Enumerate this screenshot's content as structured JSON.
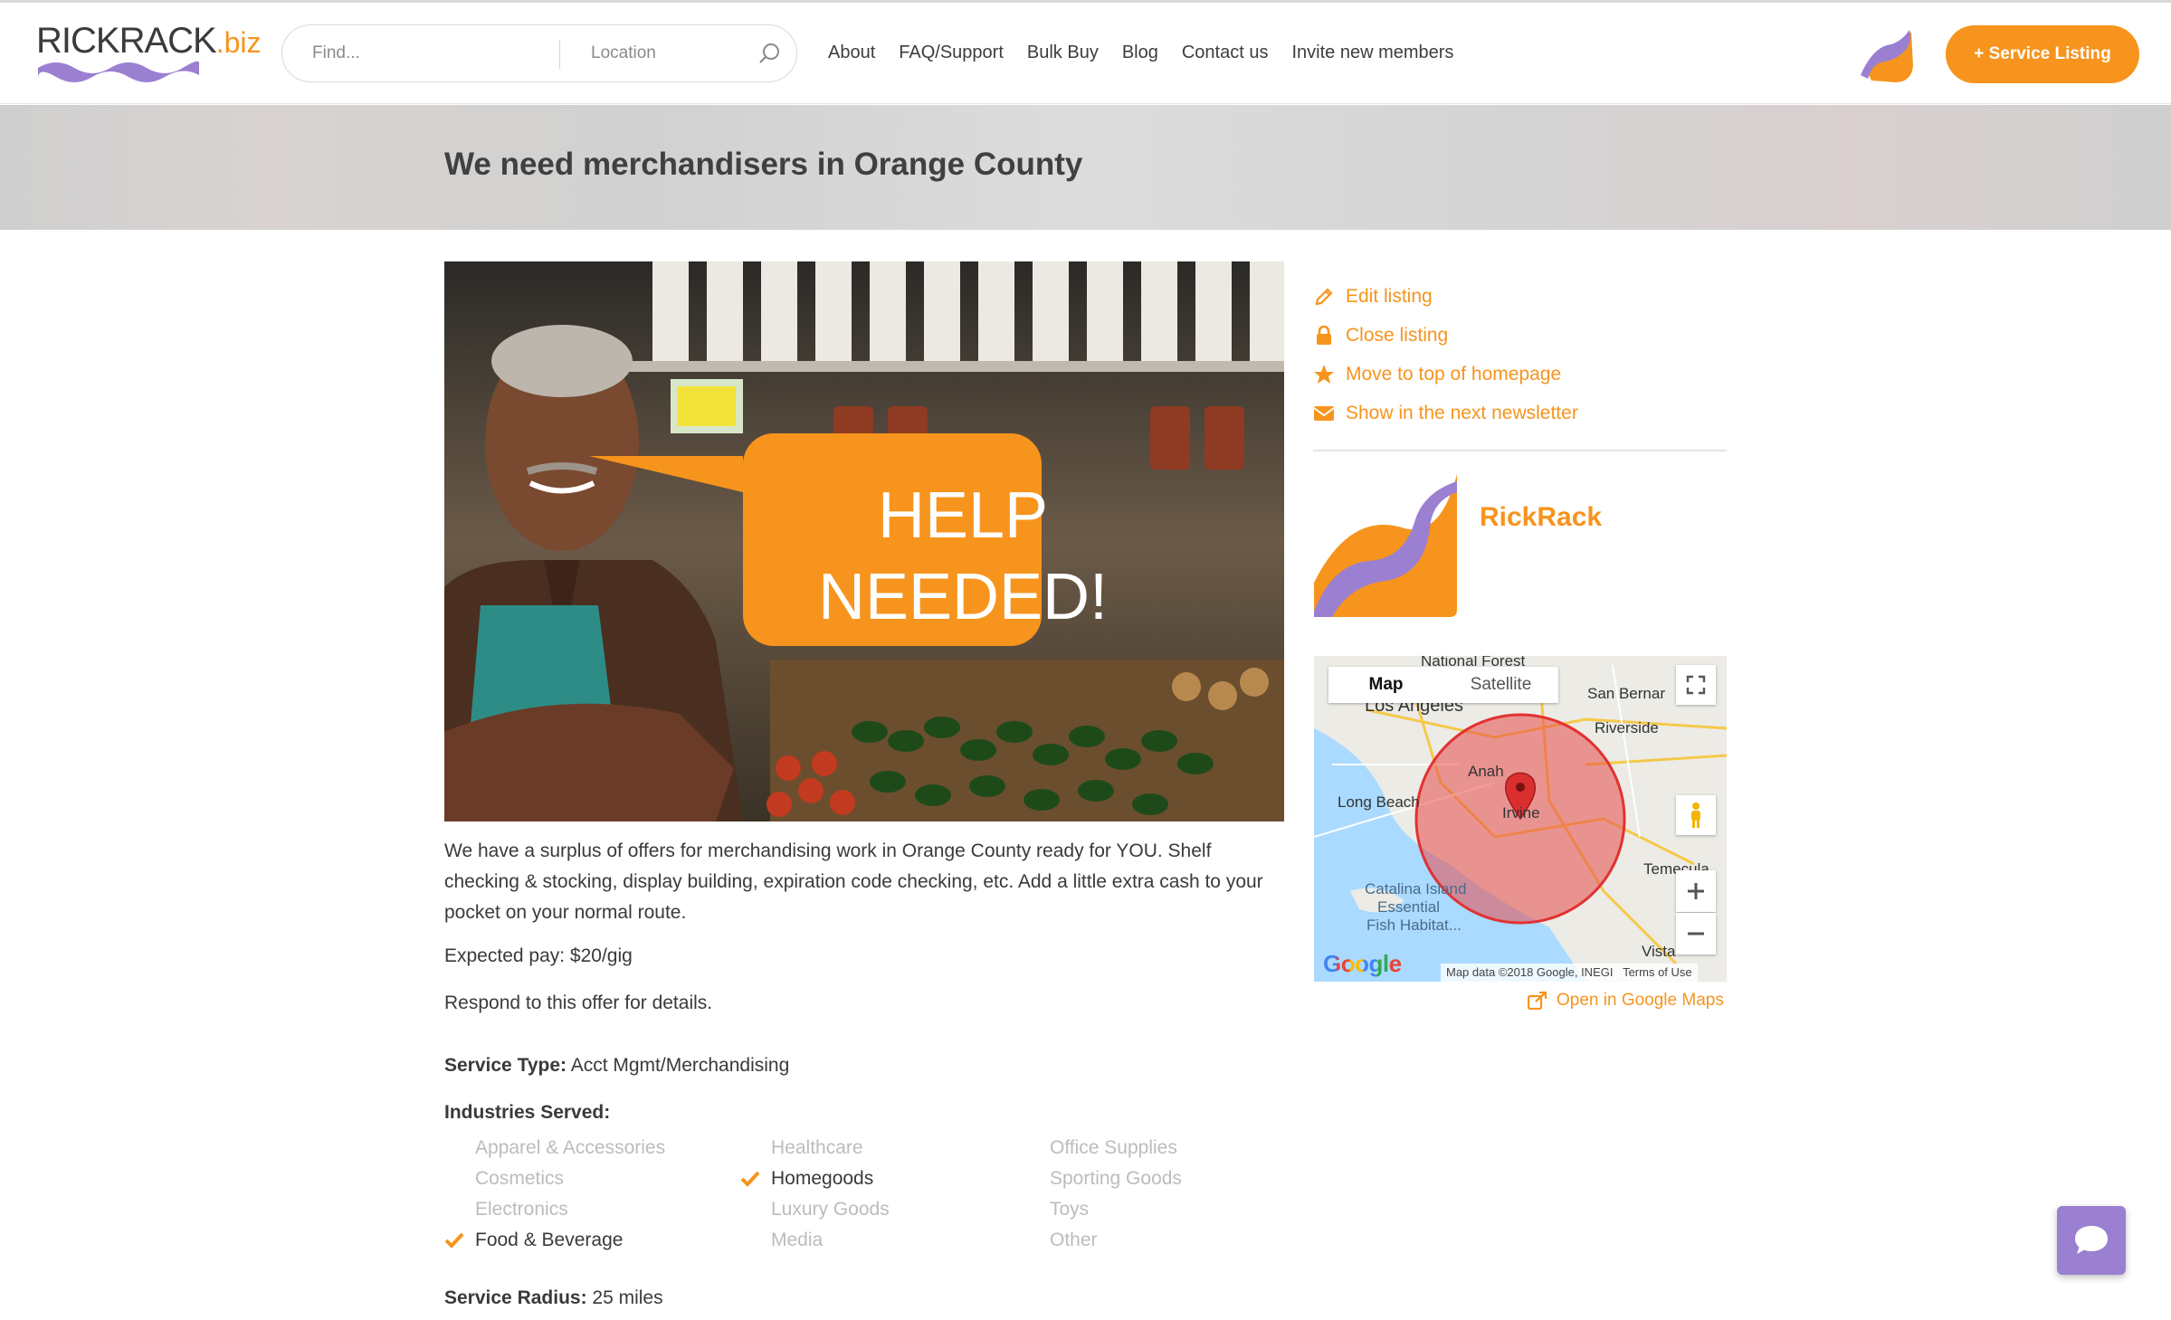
{
  "brand": {
    "logo_main": "RICKRACK",
    "logo_tld": ".biz",
    "orange": "#f7941d",
    "purple": "#9b7fd1"
  },
  "search": {
    "find_placeholder": "Find...",
    "location_placeholder": "Location",
    "icon": "search-icon"
  },
  "nav": [
    "About",
    "FAQ/Support",
    "Bulk Buy",
    "Blog",
    "Contact us",
    "Invite new members"
  ],
  "header": {
    "service_button": "+ Service Listing",
    "avatar_icon": "user-avatar"
  },
  "page": {
    "title": "We need merchandisers in Orange County"
  },
  "hero": {
    "bubble_line1": "HELP",
    "bubble_line2": "NEEDED!"
  },
  "listing": {
    "description": "We have a surplus of offers for merchandising work in Orange County ready for YOU. Shelf checking & stocking, display building, expiration code checking, etc. Add a little extra cash to your pocket on your normal route.",
    "pay": "Expected pay: $20/gig",
    "respond": "Respond to this offer for details.",
    "service_type_label": "Service Type:",
    "service_type_value": " Acct Mgmt/Merchandising",
    "industries_label": "Industries Served:",
    "industries": [
      [
        {
          "name": "Apparel & Accessories",
          "checked": false
        },
        {
          "name": "Cosmetics",
          "checked": false
        },
        {
          "name": "Electronics",
          "checked": false
        },
        {
          "name": "Food & Beverage",
          "checked": true
        }
      ],
      [
        {
          "name": "Healthcare",
          "checked": false
        },
        {
          "name": "Homegoods",
          "checked": true
        },
        {
          "name": "Luxury Goods",
          "checked": false
        },
        {
          "name": "Media",
          "checked": false
        }
      ],
      [
        {
          "name": "Office Supplies",
          "checked": false
        },
        {
          "name": "Sporting Goods",
          "checked": false
        },
        {
          "name": "Toys",
          "checked": false
        },
        {
          "name": "Other",
          "checked": false
        }
      ]
    ],
    "radius_label": "Service Radius:",
    "radius_value": " 25 miles"
  },
  "actions": [
    {
      "label": "Edit listing",
      "icon": "pencil-icon"
    },
    {
      "label": "Close listing",
      "icon": "lock-icon"
    },
    {
      "label": "Move to top of homepage",
      "icon": "star-icon"
    },
    {
      "label": "Show in the next newsletter",
      "icon": "envelope-icon"
    }
  ],
  "org": {
    "name": "RickRack"
  },
  "map": {
    "tab_map": "Map",
    "tab_satellite": "Satellite",
    "labels": [
      "National Forest",
      "Los Angeles",
      "San Bernar",
      "Riverside",
      "Anah",
      "Long Beach",
      "Irvine",
      "Temecula",
      "Catalina Island",
      "Essential",
      "Fish Habitat...",
      "Vista"
    ],
    "google": "Google",
    "attribution": "Map data ©2018 Google, INEGI",
    "terms": "Terms of Use",
    "open_link": "Open in Google Maps"
  }
}
